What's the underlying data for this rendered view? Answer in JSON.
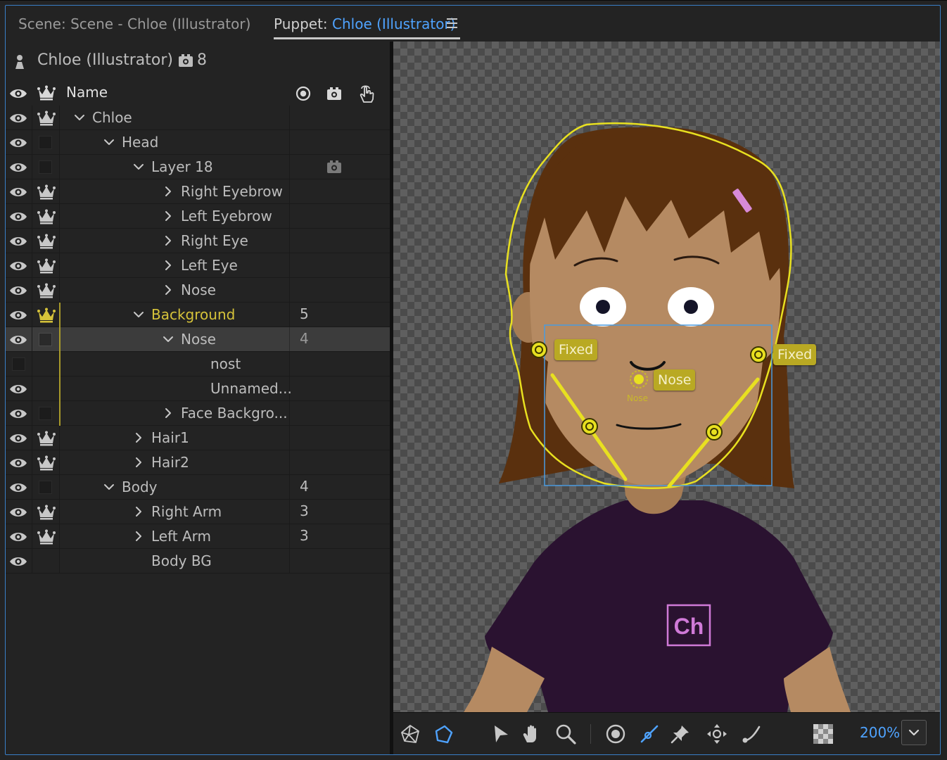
{
  "tabs": {
    "scene_label": "Scene: Scene - Chloe (Illustrator)",
    "puppet_prefix": "Puppet: ",
    "puppet_name": "Chloe (Illustrator)"
  },
  "puppet_panel": {
    "puppet_name": "Chloe (Illustrator)",
    "camera_count": "8",
    "column_name": "Name"
  },
  "layers": [
    {
      "name": "Chloe",
      "vis": "crown",
      "eye": true,
      "depth": 0,
      "caret": "down",
      "count": ""
    },
    {
      "name": "Head",
      "vis": "square",
      "eye": true,
      "depth": 1,
      "caret": "down",
      "count": ""
    },
    {
      "name": "Layer 18",
      "vis": "square",
      "eye": true,
      "depth": 2,
      "caret": "down",
      "count": "",
      "camera": true
    },
    {
      "name": "Right Eyebrow",
      "vis": "crown",
      "eye": true,
      "depth": 3,
      "caret": "right",
      "count": ""
    },
    {
      "name": "Left Eyebrow",
      "vis": "crown",
      "eye": true,
      "depth": 3,
      "caret": "right",
      "count": ""
    },
    {
      "name": "Right Eye",
      "vis": "crown",
      "eye": true,
      "depth": 3,
      "caret": "right",
      "count": ""
    },
    {
      "name": "Left Eye",
      "vis": "crown",
      "eye": true,
      "depth": 3,
      "caret": "right",
      "count": ""
    },
    {
      "name": "Nose",
      "vis": "crown",
      "eye": true,
      "depth": 3,
      "caret": "right",
      "count": ""
    },
    {
      "name": "Background",
      "vis": "crown-gold",
      "eye": true,
      "depth": 2,
      "caret": "down",
      "count": "5",
      "gold": true
    },
    {
      "name": "Nose",
      "vis": "square",
      "eye": true,
      "depth": 3,
      "caret": "down",
      "count": "4",
      "selected": true
    },
    {
      "name": "nost",
      "vis": "none",
      "eye": false,
      "depth": 4,
      "caret": "none",
      "count": ""
    },
    {
      "name": "Unnamed...",
      "vis": "none",
      "eye": true,
      "depth": 4,
      "caret": "none",
      "count": ""
    },
    {
      "name": "Face Backgro...",
      "vis": "square",
      "eye": true,
      "depth": 3,
      "caret": "right",
      "count": ""
    },
    {
      "name": "Hair1",
      "vis": "crown",
      "eye": true,
      "depth": 2,
      "caret": "right",
      "count": ""
    },
    {
      "name": "Hair2",
      "vis": "crown",
      "eye": true,
      "depth": 2,
      "caret": "right",
      "count": ""
    },
    {
      "name": "Body",
      "vis": "square",
      "eye": true,
      "depth": 1,
      "caret": "down",
      "count": "4"
    },
    {
      "name": "Right Arm",
      "vis": "crown",
      "eye": true,
      "depth": 2,
      "caret": "right",
      "count": "3"
    },
    {
      "name": "Left Arm",
      "vis": "crown",
      "eye": true,
      "depth": 2,
      "caret": "right",
      "count": "3"
    },
    {
      "name": "Body BG",
      "vis": "none",
      "eye": true,
      "depth": 2,
      "caret": "none",
      "count": ""
    }
  ],
  "canvas": {
    "handle_fixed_left": "Fixed",
    "handle_fixed_right": "Fixed",
    "handle_nose": "Nose",
    "handle_nose_sub": "Nose",
    "shirt_logo": "Ch"
  },
  "toolbar": {
    "zoom": "200%",
    "tools": [
      "mesh-icon",
      "shape-icon",
      "select-arrow-icon",
      "hand-icon",
      "zoom-icon",
      "origin-handle-icon",
      "stick-icon",
      "pin-icon",
      "dragger-icon",
      "bend-icon",
      "transparency-icon"
    ]
  },
  "colors": {
    "accent": "#4fa3ff",
    "handle": "#e8e020",
    "handle_label_bg": "#b9a923",
    "hair": "#5a300e",
    "skin": "#b58a62",
    "shirt": "#2a1230",
    "logo": "#d07ad8"
  }
}
